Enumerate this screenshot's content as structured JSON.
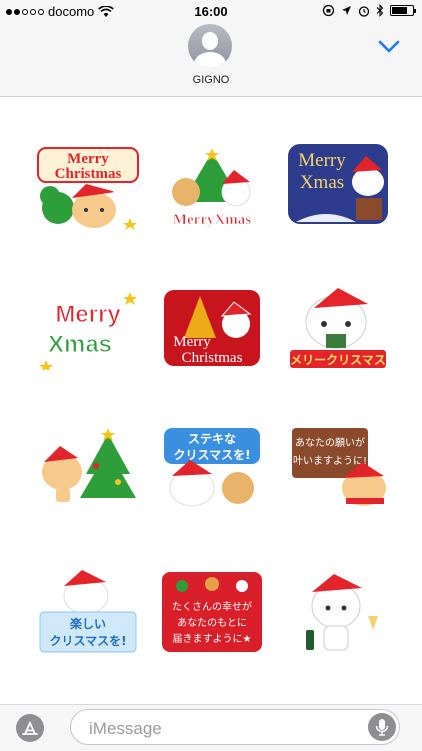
{
  "status_bar": {
    "carrier": "docomo",
    "time": "16:00"
  },
  "header": {
    "contact_name": "GIGNO"
  },
  "stickers": [
    {
      "text1": "Merry",
      "text2": "Christmas"
    },
    {
      "text1": "MerryXmas"
    },
    {
      "text1": "Merry",
      "text2": "Xmas"
    },
    {
      "text1": "Merry",
      "text2": "Xmas"
    },
    {
      "text1": "Merry",
      "text2": "Christmas"
    },
    {
      "text1": "メリークリスマス"
    },
    {
      "text1": ""
    },
    {
      "text1": "ステキな",
      "text2": "クリスマスを!"
    },
    {
      "text1": "あなたの願いが",
      "text2": "叶いますように!"
    },
    {
      "text1": "楽しい",
      "text2": "クリスマスを!"
    },
    {
      "text1": "たくさんの幸せが",
      "text2": "あなたのもとに",
      "text3": "届きますように★"
    },
    {
      "text1": ""
    }
  ],
  "compose": {
    "placeholder": "iMessage"
  },
  "colors": {
    "accent": "#1a7cf3",
    "red": "#e3242b",
    "green": "#2e9e3a",
    "gold": "#f5c518"
  }
}
